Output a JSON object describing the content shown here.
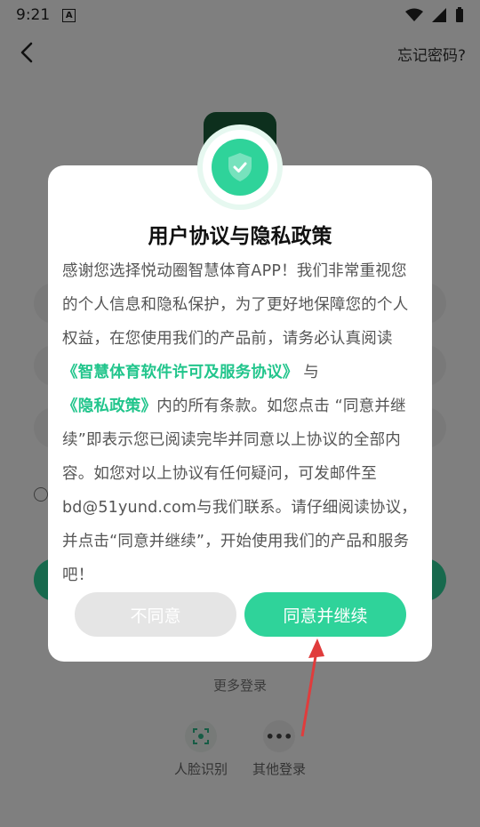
{
  "status_bar": {
    "time": "9:21",
    "icons": [
      "a-notification-icon",
      "wifi-icon",
      "signal-icon",
      "battery-icon"
    ]
  },
  "top_bar": {
    "back_icon": "back-arrow-icon",
    "forgot_password": "忘记密码?"
  },
  "background": {
    "more_login": "更多登录",
    "face_login": "人脸识别",
    "other_login": "其他登录"
  },
  "dialog": {
    "title": "用户协议与隐私政策",
    "body_part1": "感谢您选择悦动圈智慧体育APP！我们非常重视您的个人信息和隐私保护，为了更好地保障您的个人权益，在您使用我们的产品前，请务必认真阅读",
    "link_license": "《智慧体育软件许可及服务协议》",
    "body_and": "与",
    "link_privacy": "《隐私政策》",
    "body_part2": "内的所有条款。如您点击 “同意并继续”即表示您已阅读完毕并同意以上协议的全部内容。如您对以上协议有任何疑问，可发邮件至bd@51yund.com与我们联系。请仔细阅读协议，并点击“同意并继续”，开始使用我们的产品和服务吧！",
    "disagree_label": "不同意",
    "agree_label": "同意并继续"
  },
  "colors": {
    "accent": "#2fd39a",
    "link": "#22c58c",
    "annotation_arrow": "#e03c3c"
  }
}
